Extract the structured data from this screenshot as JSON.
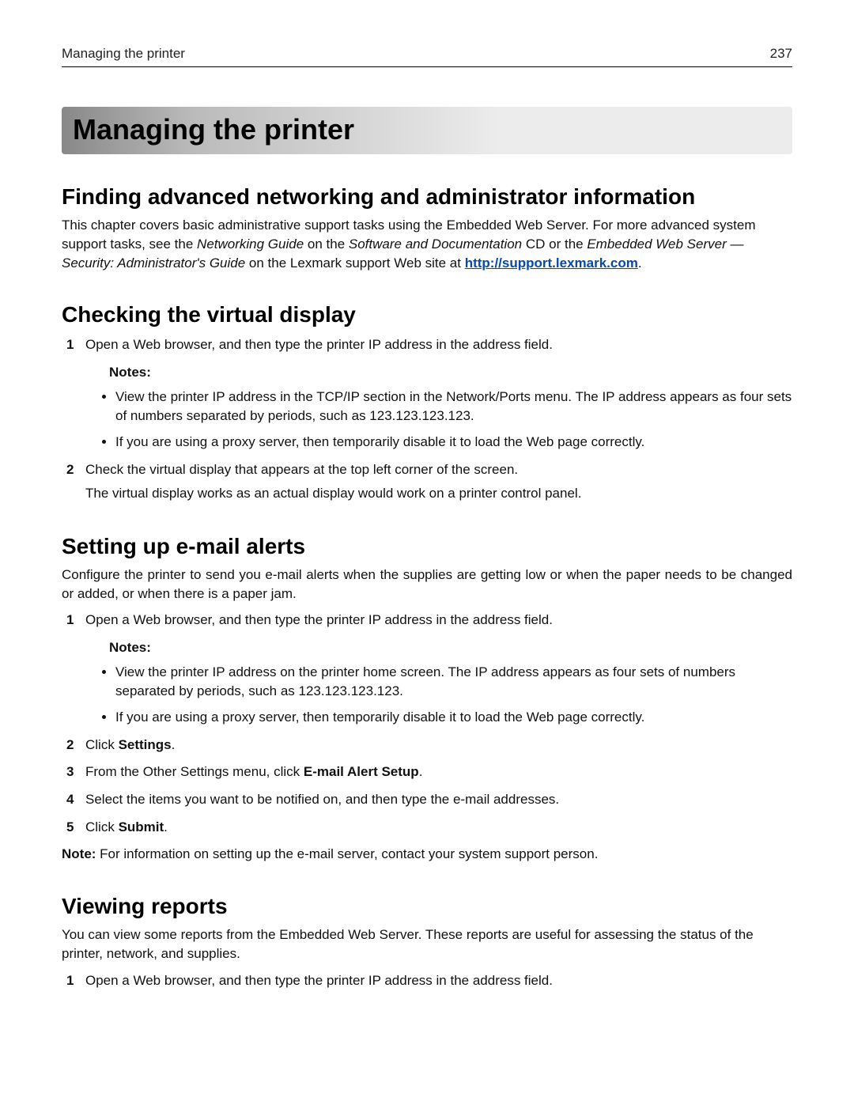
{
  "header": {
    "section_title": "Managing the printer",
    "page_number": "237"
  },
  "banner": {
    "title": "Managing the printer"
  },
  "sections": {
    "s1": {
      "heading": "Finding advanced networking and administrator information",
      "para_part1": "This chapter covers basic administrative support tasks using the Embedded Web Server. For more advanced system support tasks, see the ",
      "em1": "Networking Guide",
      "para_mid1": " on the ",
      "em2": "Software and Documentation",
      "para_mid2": " CD or the ",
      "em3": "Embedded Web Server — Security: Administrator's Guide",
      "para_mid3": " on the Lexmark support Web site at ",
      "link_text": "http://support.lexmark.com",
      "link_after": "."
    },
    "s2": {
      "heading": "Checking the virtual display",
      "step1": "Open a Web browser, and then type the printer IP address in the address field.",
      "notes_label": "Notes:",
      "note1": "View the printer IP address in the TCP/IP section in the Network/Ports menu. The IP address appears as four sets of numbers separated by periods, such as 123.123.123.123.",
      "note2": "If you are using a proxy server, then temporarily disable it to load the Web page correctly.",
      "step2": "Check the virtual display that appears at the top left corner of the screen.",
      "step2_sub": "The virtual display works as an actual display would work on a printer control panel."
    },
    "s3": {
      "heading": "Setting up e‑mail alerts",
      "intro": "Configure the printer to send you e-mail alerts when the supplies are getting low or when the paper needs to be changed or added, or when there is a paper jam.",
      "step1": "Open a Web browser, and then type the printer IP address in the address field.",
      "notes_label": "Notes:",
      "note1": "View the printer IP address on the printer home screen. The IP address appears as four sets of numbers separated by periods, such as 123.123.123.123.",
      "note2": "If you are using a proxy server, then temporarily disable it to load the Web page correctly.",
      "step2_pre": "Click ",
      "step2_bold": "Settings",
      "step2_post": ".",
      "step3_pre": "From the Other Settings menu, click ",
      "step3_bold": "E‑mail Alert Setup",
      "step3_post": ".",
      "step4": "Select the items you want to be notified on, and then type the e‑mail addresses.",
      "step5_pre": "Click ",
      "step5_bold": "Submit",
      "step5_post": ".",
      "footnote_bold": "Note:",
      "footnote_rest": " For information on setting up the e‑mail server, contact your system support person."
    },
    "s4": {
      "heading": "Viewing reports",
      "intro": "You can view some reports from the Embedded Web Server. These reports are useful for assessing the status of the printer, network, and supplies.",
      "step1": "Open a Web browser, and then type the printer IP address in the address field."
    }
  }
}
